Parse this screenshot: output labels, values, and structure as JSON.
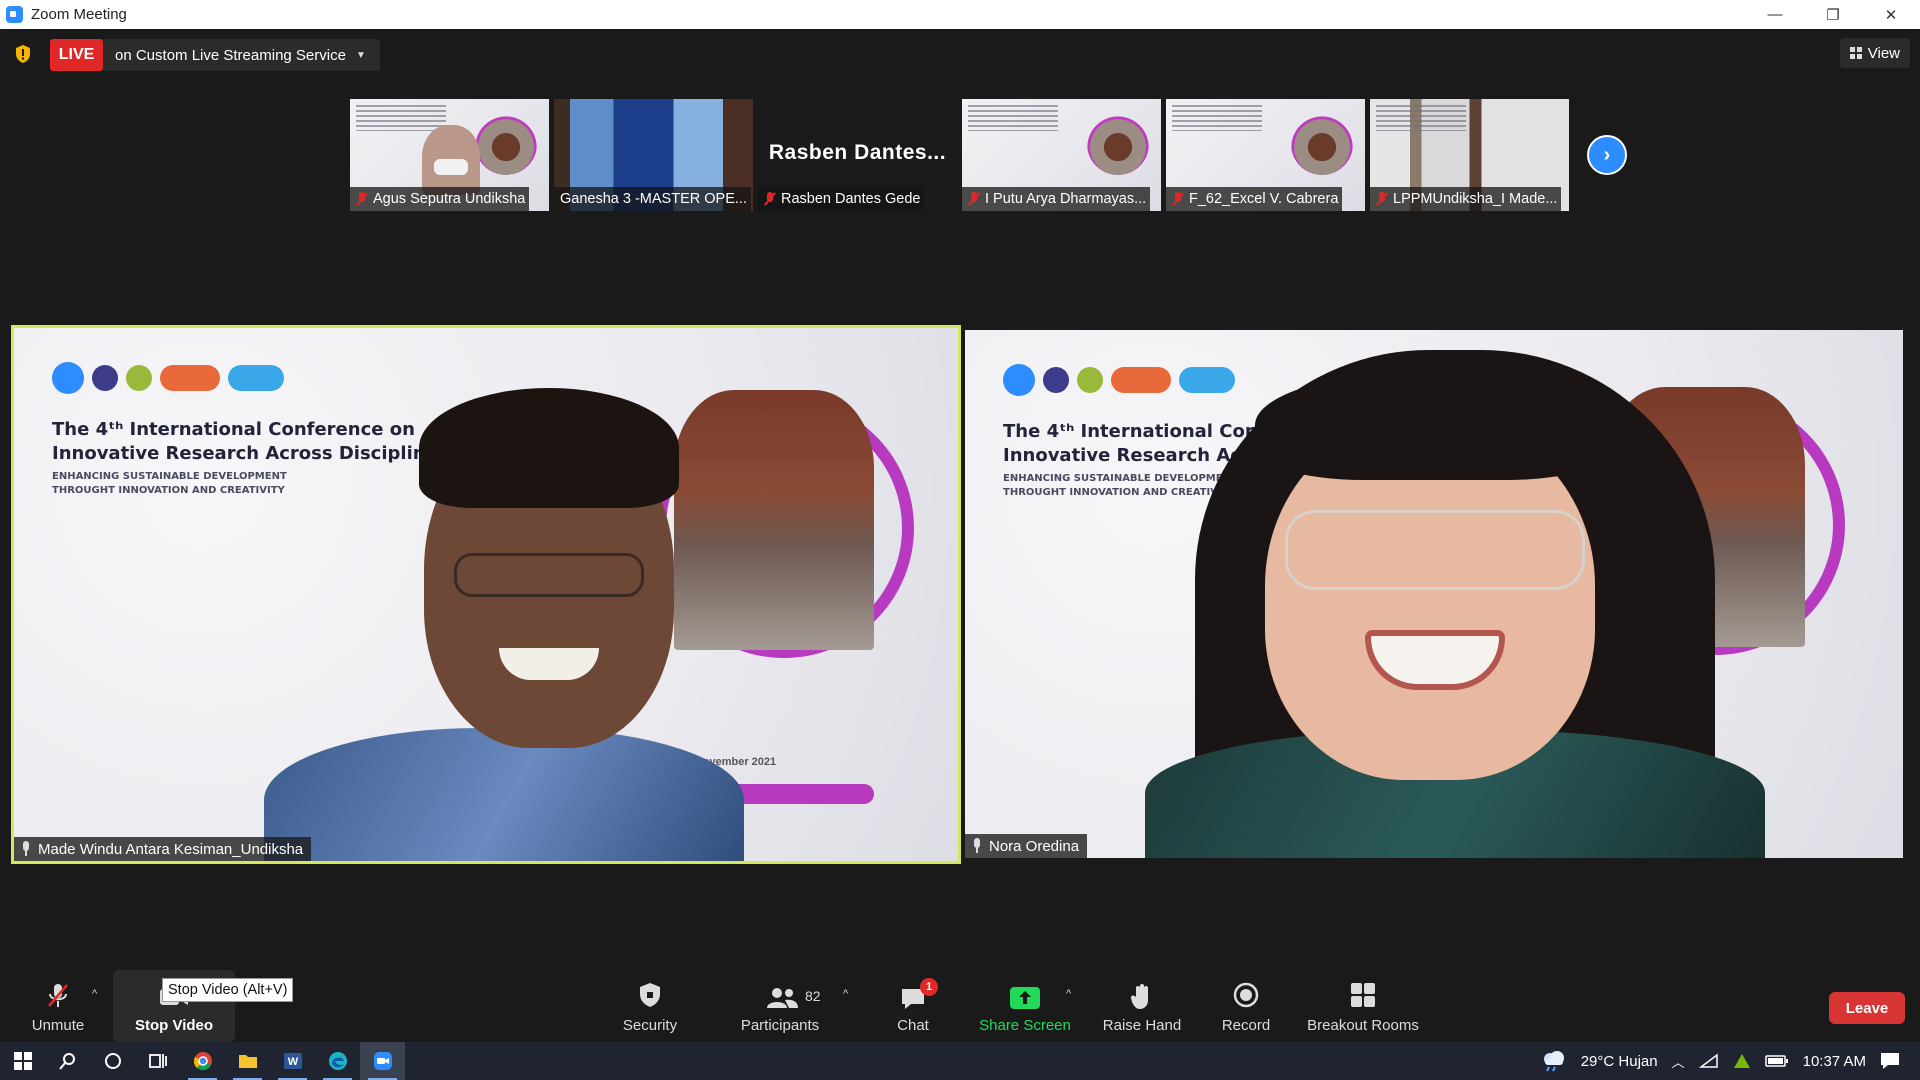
{
  "window": {
    "title": "Zoom Meeting",
    "controls": [
      "—",
      "❐",
      "✕"
    ]
  },
  "topbar": {
    "live_label": "LIVE",
    "live_service": "on Custom Live Streaming Service",
    "view_label": "View"
  },
  "thumbnails": [
    {
      "name": "Agus Seputra Undiksha",
      "muted": true
    },
    {
      "name": "Ganesha 3 -MASTER OPE...",
      "muted": false
    },
    {
      "name": "Rasben Dantes Gede",
      "display_name": "Rasben  Dantes...",
      "muted": true
    },
    {
      "name": "I Putu Arya Dharmayas...",
      "muted": true
    },
    {
      "name": "F_62_Excel V. Cabrera",
      "muted": true
    },
    {
      "name": "LPPMUndiksha_I Made...",
      "muted": true
    }
  ],
  "main_videos": [
    {
      "name": "Made Windu Antara Kesiman_Undiksha",
      "active_speaker": true
    },
    {
      "name": "Nora Oredina",
      "active_speaker": false
    }
  ],
  "slide": {
    "title_line1": "The 4ᵗʰ International Conference on",
    "title_line2": "Innovative Research Across Disciplines",
    "sub_line1": "ENHANCING SUSTAINABLE DEVELOPMENT",
    "sub_line2": "THROUGHT INNOVATION AND CREATIVITY",
    "date": "2ⁿᵈ - 3ʳᵈ November 2021"
  },
  "toolbar": {
    "unmute": "Unmute",
    "stop_video": "Stop Video",
    "tooltip": "Stop Video (Alt+V)",
    "security": "Security",
    "participants": "Participants",
    "participants_count": "82",
    "chat": "Chat",
    "chat_badge": "1",
    "share_screen": "Share Screen",
    "raise_hand": "Raise Hand",
    "record": "Record",
    "breakout_rooms": "Breakout Rooms",
    "leave": "Leave"
  },
  "taskbar": {
    "weather": "29°C  Hujan",
    "time": "10:37 AM"
  },
  "colors": {
    "live_red": "#e02828",
    "active_speaker_border": "#d4e85a",
    "share_green": "#23d959",
    "leave_red": "#d93434",
    "zoom_blue": "#2d8cff"
  }
}
